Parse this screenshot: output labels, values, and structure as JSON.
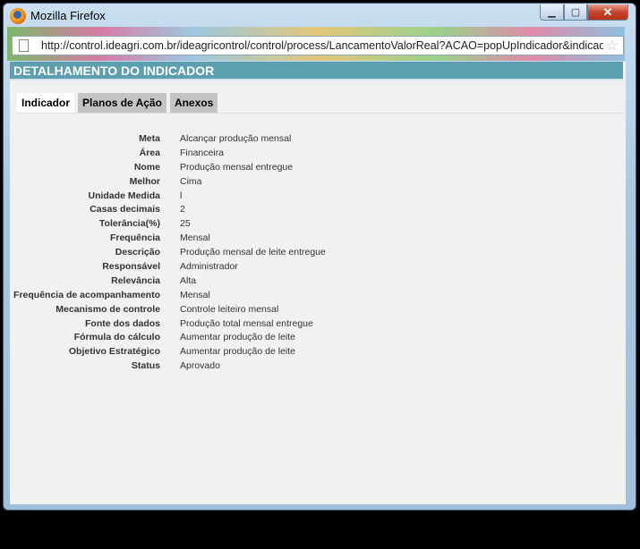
{
  "window": {
    "title": "Mozilla Firefox",
    "min": "▭",
    "max": "□",
    "close": "✕"
  },
  "address": {
    "url": "http://control.ideagri.com.br/ideagricontrol/control/process/LancamentoValorReal?ACAO=popUpIndicador&indicador"
  },
  "header": {
    "title": "DETALHAMENTO DO INDICADOR"
  },
  "tabs": [
    {
      "label": "Indicador"
    },
    {
      "label": "Planos de Ação"
    },
    {
      "label": "Anexos"
    }
  ],
  "details": [
    {
      "label": "Meta",
      "value": "Alcançar produção mensal"
    },
    {
      "label": "Área",
      "value": "Financeira"
    },
    {
      "label": "Nome",
      "value": "Produção mensal entregue"
    },
    {
      "label": "Melhor",
      "value": "Cima"
    },
    {
      "label": "Unidade Medida",
      "value": "l"
    },
    {
      "label": "Casas decimais",
      "value": "2"
    },
    {
      "label": "Tolerância(%)",
      "value": "25"
    },
    {
      "label": "Frequência",
      "value": "Mensal"
    },
    {
      "label": "Descrição",
      "value": "Produção mensal de leite entregue"
    },
    {
      "label": "Responsável",
      "value": "Administrador"
    },
    {
      "label": "Relevância",
      "value": "Alta"
    },
    {
      "label": "Frequência de acompanhamento",
      "value": "Mensal"
    },
    {
      "label": "Mecanismo de controle",
      "value": "Controle leiteiro mensal"
    },
    {
      "label": "Fonte dos dados",
      "value": "Produção total mensal entregue"
    },
    {
      "label": "Fórmula do cálculo",
      "value": "Aumentar produção de leite"
    },
    {
      "label": "Objetivo Estratégico",
      "value": "Aumentar produção de leite"
    },
    {
      "label": "Status",
      "value": "Aprovado"
    }
  ]
}
